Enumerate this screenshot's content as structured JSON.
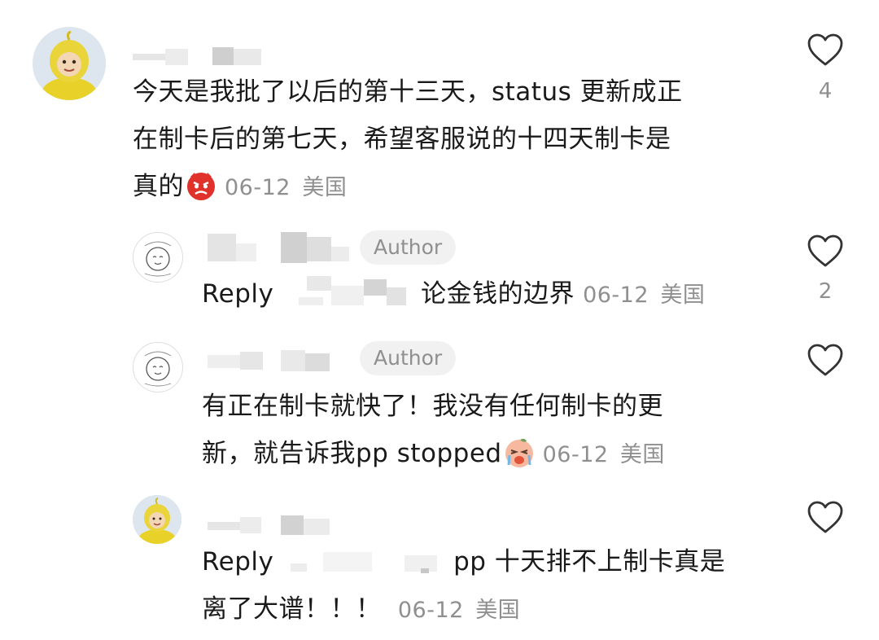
{
  "comments": [
    {
      "text_line1": "今天是我批了以后的第十三天，status 更新成正",
      "text_line2": "在制卡后的第七天，希望客服说的十四天制卡是",
      "text_line3": "真的",
      "emoji": "angry-face-icon",
      "date": "06-12",
      "location": "美国",
      "likes": "4"
    },
    {
      "badge": "Author",
      "reply_label": "Reply",
      "text": "论金钱的边界",
      "date": "06-12",
      "location": "美国",
      "likes": "2"
    },
    {
      "badge": "Author",
      "text_line1": "有正在制卡就快了！我没有任何制卡的更",
      "text_line2": "新，就告诉我pp stopped",
      "emoji": "crying-face-icon",
      "date": "06-12",
      "location": "美国"
    },
    {
      "reply_label": "Reply",
      "text_line1": "pp 十天排不上制卡真是",
      "text_line2": "离了大谱！！！",
      "date": "06-12",
      "location": "美国"
    }
  ]
}
